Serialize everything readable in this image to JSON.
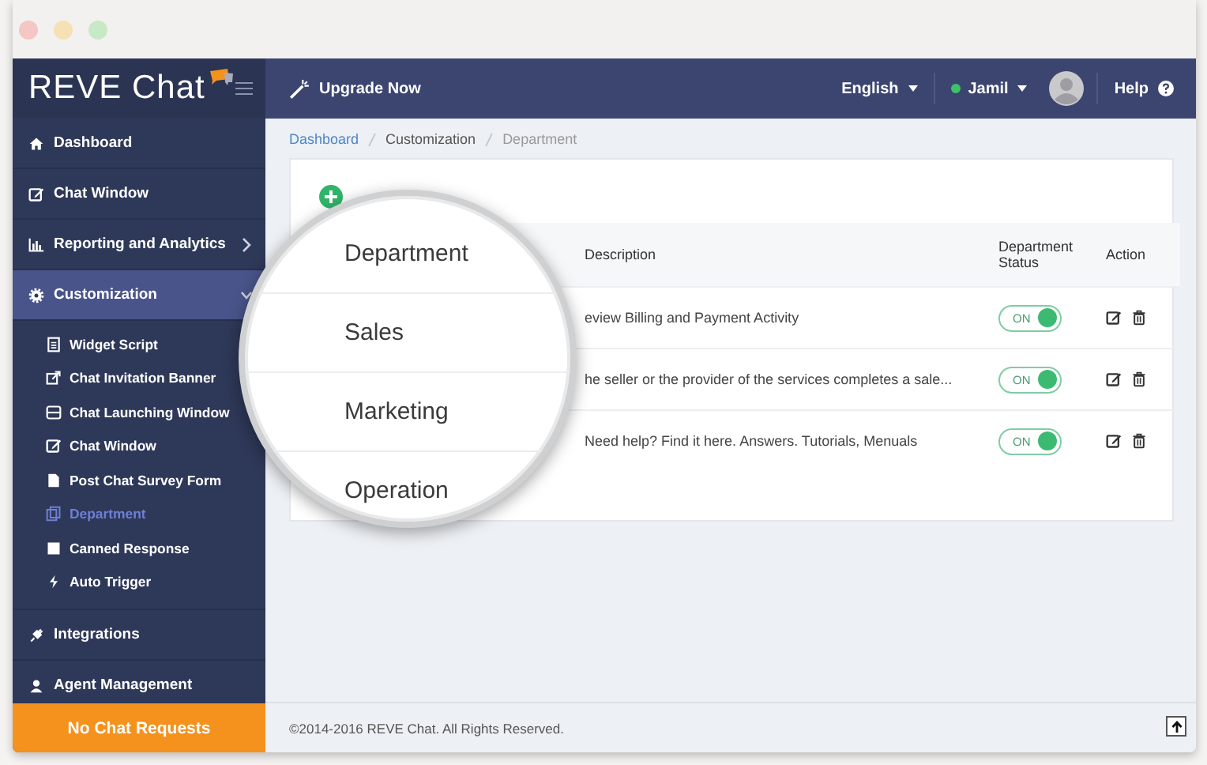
{
  "sidebar": {
    "logo": "REVE Chat",
    "items": [
      {
        "label": "Dashboard",
        "kind": "link",
        "selected": false
      },
      {
        "label": "Chat Window",
        "kind": "link",
        "selected": false
      },
      {
        "label": "Reporting and Analytics",
        "kind": "group",
        "expanded": false,
        "selected": false
      },
      {
        "label": "Customization",
        "kind": "group",
        "expanded": true,
        "selected": true,
        "children": [
          {
            "label": "Widget Script",
            "selected": false
          },
          {
            "label": "Chat Invitation Banner",
            "selected": false
          },
          {
            "label": "Chat Launching Window",
            "selected": false
          },
          {
            "label": "Chat Window",
            "selected": false
          },
          {
            "label": "Post Chat Survey Form",
            "selected": false
          },
          {
            "label": "Department",
            "selected": true
          },
          {
            "label": "Canned Response",
            "selected": false
          },
          {
            "label": "Auto Trigger",
            "selected": false
          }
        ]
      },
      {
        "label": "Integrations",
        "kind": "link",
        "selected": false
      },
      {
        "label": "Agent Management",
        "kind": "link",
        "selected": false
      }
    ],
    "requests": "No Chat Requests"
  },
  "topbar": {
    "upgrade": "Upgrade Now",
    "language": "English",
    "user": {
      "name": "Jamil",
      "online": true
    },
    "help": "Help"
  },
  "breadcrumb": [
    "Dashboard",
    "Customization",
    "Department"
  ],
  "table": {
    "columns": [
      "Description",
      "Department Status",
      "Action"
    ],
    "rows": [
      {
        "description": "eview Billing and Payment Activity",
        "status": "ON",
        "on": true
      },
      {
        "description": "he seller or the provider of the services completes a sale...",
        "status": "ON",
        "on": true
      },
      {
        "description": "Need help? Find it here. Answers. Tutorials, Menuals",
        "status": "ON",
        "on": true
      }
    ]
  },
  "magnifier": {
    "header": "Department",
    "rows": [
      "Sales",
      "Marketing",
      "Operation"
    ]
  },
  "footer": "©2014-2016 REVE Chat. All Rights Reserved."
}
